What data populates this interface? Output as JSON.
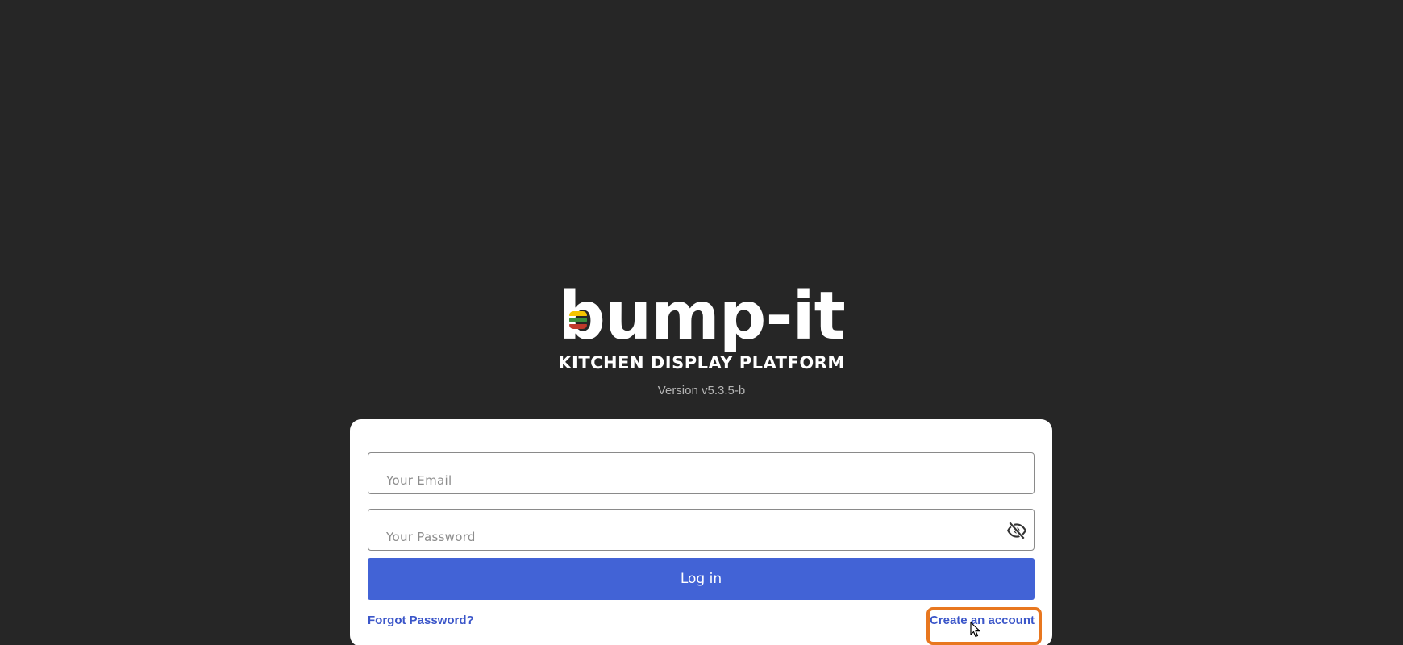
{
  "brand": {
    "logo_text": "bump-it",
    "logo_rest": "ump-it",
    "logo_first_letter": "b",
    "tagline": "KITCHEN DISPLAY PLATFORM",
    "version": "Version v5.3.5-b"
  },
  "login": {
    "email_placeholder": "Your Email",
    "password_placeholder": "Your Password",
    "login_label": "Log in",
    "forgot_label": "Forgot Password?",
    "create_label": "Create an account"
  },
  "colors": {
    "background": "#262626",
    "accent": "#4263d6",
    "link": "#3b56c9",
    "highlight": "#e8771f"
  },
  "icons": {
    "password_toggle": "eye-off-icon",
    "logo_mark": "burger-icon"
  }
}
